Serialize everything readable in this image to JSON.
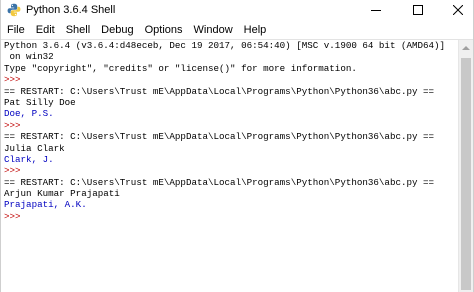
{
  "window": {
    "title": "Python 3.6.4 Shell"
  },
  "menu": {
    "items": [
      "File",
      "Edit",
      "Shell",
      "Debug",
      "Options",
      "Window",
      "Help"
    ]
  },
  "shell": {
    "lines": [
      {
        "type": "stdout",
        "text": "Python 3.6.4 (v3.6.4:d48eceb, Dec 19 2017, 06:54:40) [MSC v.1900 64 bit (AMD64)]"
      },
      {
        "type": "stdout",
        "text": " on win32"
      },
      {
        "type": "stdout",
        "text": "Type \"copyright\", \"credits\" or \"license()\" for more information."
      },
      {
        "type": "prompt",
        "text": ">>> "
      },
      {
        "type": "stdout",
        "text": "== RESTART: C:\\Users\\Trust mE\\AppData\\Local\\Programs\\Python\\Python36\\abc.py =="
      },
      {
        "type": "stdout",
        "text": "Pat Silly Doe"
      },
      {
        "type": "output",
        "text": "Doe, P.S."
      },
      {
        "type": "prompt",
        "text": ">>> "
      },
      {
        "type": "stdout",
        "text": "== RESTART: C:\\Users\\Trust mE\\AppData\\Local\\Programs\\Python\\Python36\\abc.py =="
      },
      {
        "type": "stdout",
        "text": "Julia Clark"
      },
      {
        "type": "output",
        "text": "Clark, J."
      },
      {
        "type": "prompt",
        "text": ">>> "
      },
      {
        "type": "stdout",
        "text": "== RESTART: C:\\Users\\Trust mE\\AppData\\Local\\Programs\\Python\\Python36\\abc.py =="
      },
      {
        "type": "stdout",
        "text": "Arjun Kumar Prajapati"
      },
      {
        "type": "output",
        "text": "Prajapati, A.K."
      },
      {
        "type": "prompt",
        "text": ">>> "
      }
    ]
  },
  "colors": {
    "prompt": "#c00000",
    "output": "#0000c0",
    "stdout": "#000000"
  },
  "icons": {
    "app": "python-icon",
    "minimize": "minimize-icon",
    "maximize": "maximize-icon",
    "close": "close-icon"
  }
}
